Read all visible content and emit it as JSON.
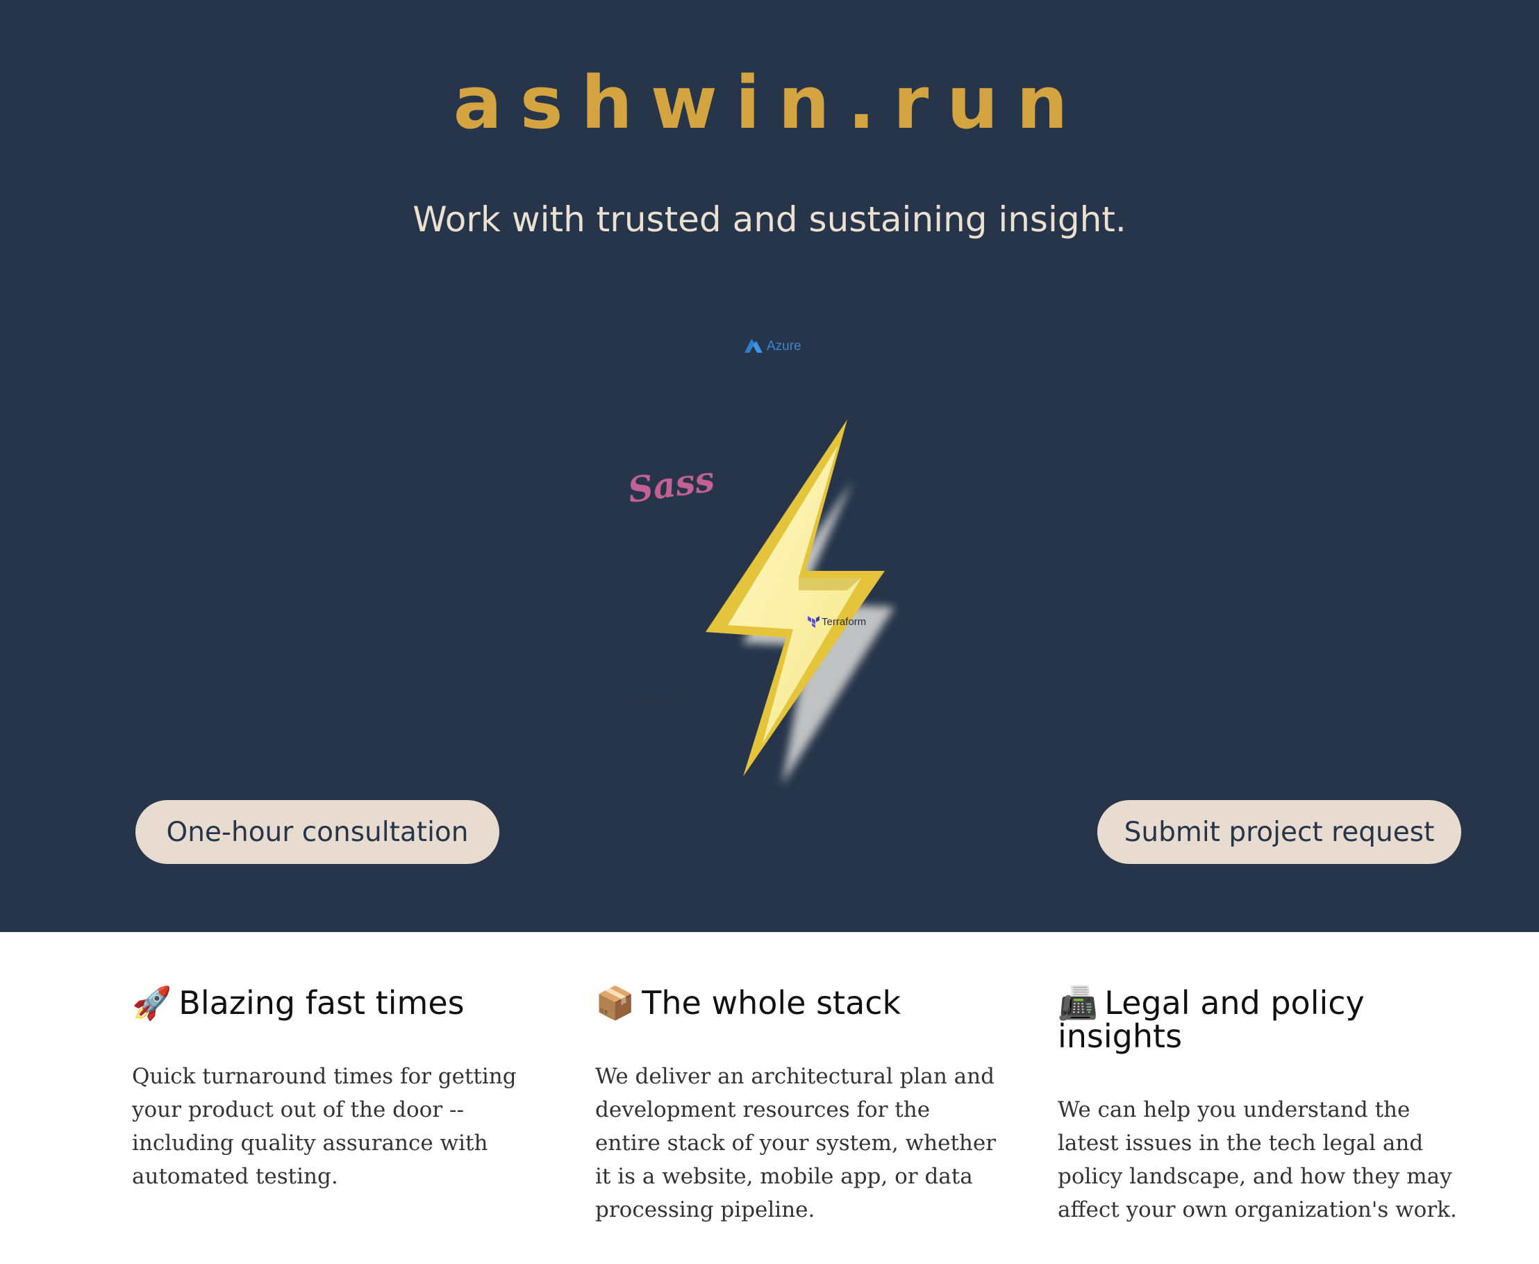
{
  "site": {
    "brand": "ashwin.run",
    "tagline": "Work with trusted and sustaining insight."
  },
  "hero": {
    "logos": {
      "azure": "Azure",
      "sass": "Sass",
      "terraform": "Terraform"
    },
    "center_icon": "lightning-bolt-icon"
  },
  "actions": {
    "consultation_label": "One-hour consultation",
    "project_request_label": "Submit project request"
  },
  "features": [
    {
      "icon": "🚀",
      "title": "Blazing fast times",
      "body": "Quick turnaround times for getting your product out of the door -- including quality assurance with automated testing."
    },
    {
      "icon": "📦",
      "title": "The whole stack",
      "body": "We deliver an architectural plan and development resources for the entire stack of your system, whether it is a website, mobile app, or data processing pipeline."
    },
    {
      "icon": "📠",
      "title": "Legal and policy insights",
      "body": "We can help you understand the latest issues in the tech legal and policy landscape, and how they may affect your own organization's work."
    }
  ],
  "colors": {
    "hero_bg": "#26354a",
    "brand": "#d3a43f",
    "button_bg": "#e8dbcf",
    "tagline": "#ece0d3"
  }
}
